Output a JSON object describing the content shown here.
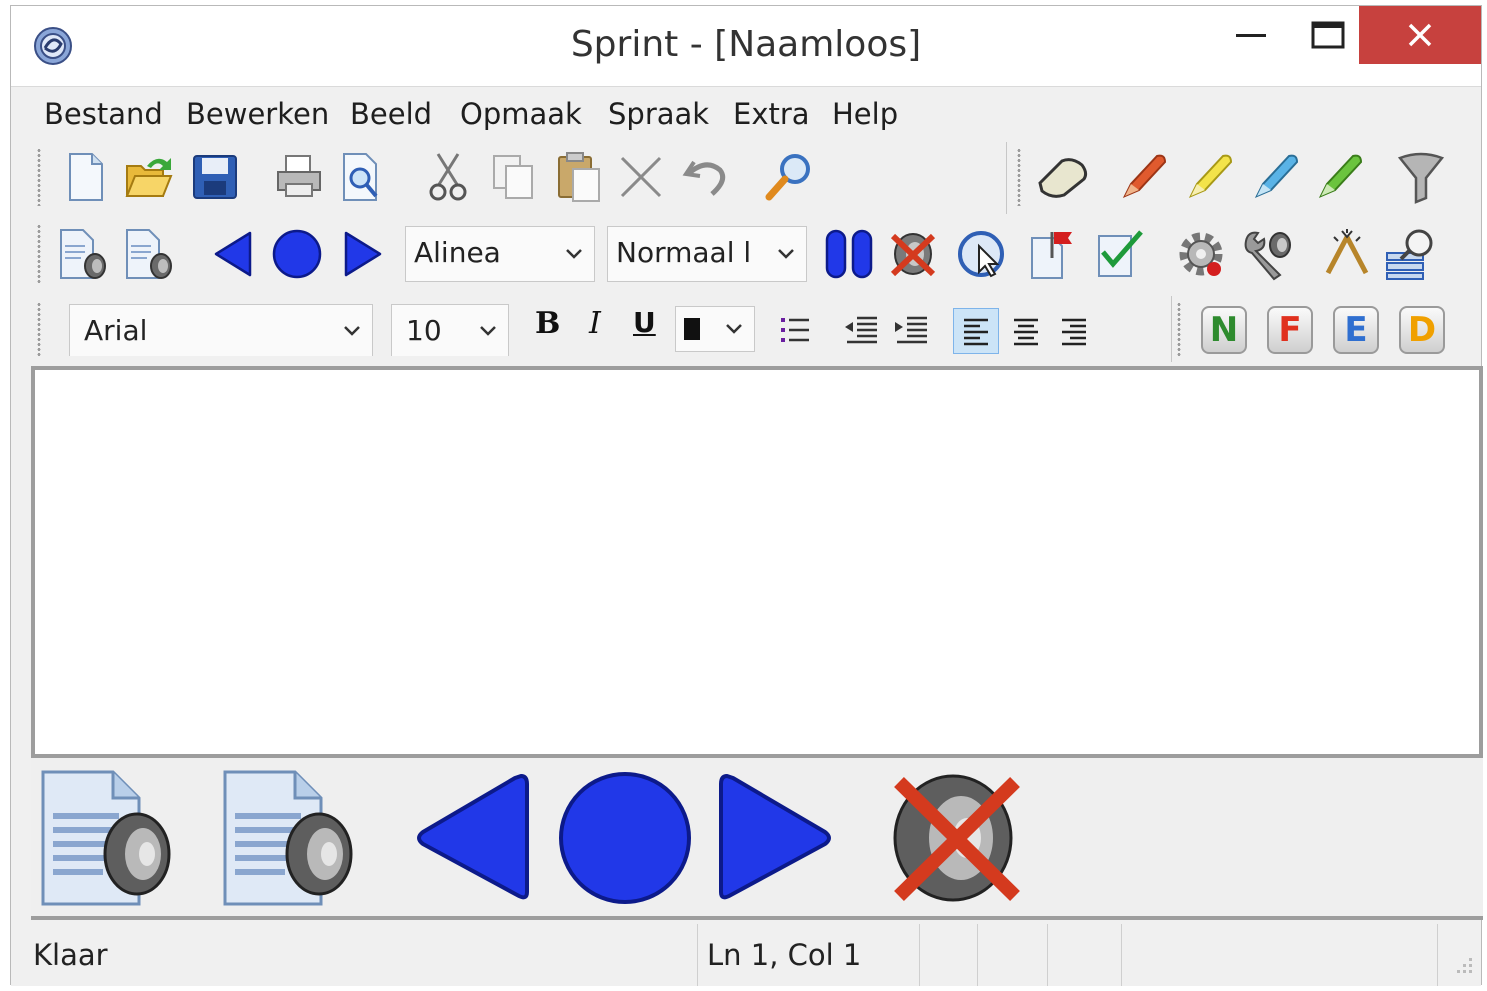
{
  "window": {
    "title": "Sprint - [Naamloos]"
  },
  "menu": [
    "Bestand",
    "Bewerken",
    "Beeld",
    "Opmaak",
    "Spraak",
    "Extra",
    "Help"
  ],
  "toolbar_main": {
    "icons": [
      "new-document-icon",
      "open-folder-icon",
      "save-icon",
      "print-icon",
      "print-preview-icon",
      "cut-icon",
      "copy-icon",
      "paste-icon",
      "delete-icon",
      "undo-icon",
      "find-icon"
    ]
  },
  "toolbar_highlight": {
    "icons": [
      "eraser-icon",
      "red-marker-icon",
      "yellow-marker-icon",
      "blue-marker-icon",
      "green-marker-icon",
      "filter-icon"
    ]
  },
  "toolbar_speech": {
    "read_unit": "Alinea",
    "reading_mode": "Normaal l"
  },
  "toolbar_format": {
    "font": "Arial",
    "size": "10",
    "bold": "B",
    "italic": "I",
    "underline": "U",
    "letters": [
      "N",
      "F",
      "E",
      "D"
    ],
    "letter_colors": [
      "#2e8b2e",
      "#e0301e",
      "#2f6fd0",
      "#f0a000"
    ]
  },
  "status": {
    "state": "Klaar",
    "position": "Ln 1, Col 1"
  },
  "colors": {
    "close_button": "#c7413e",
    "nav_blue": "#2138e8",
    "editor_border": "#9d9d9d"
  }
}
